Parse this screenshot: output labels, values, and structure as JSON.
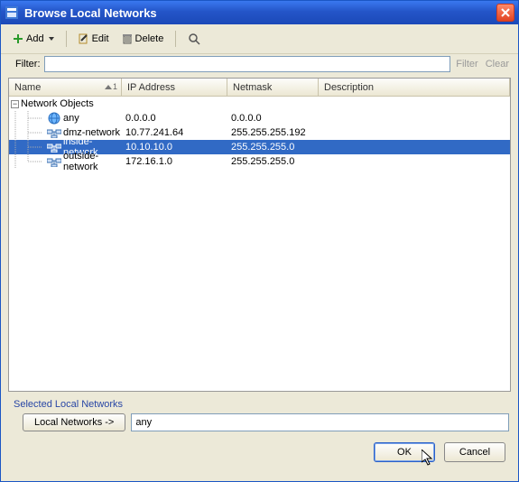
{
  "window": {
    "title": "Browse Local Networks"
  },
  "toolbar": {
    "add_label": "Add",
    "edit_label": "Edit",
    "delete_label": "Delete"
  },
  "filter": {
    "label": "Filter:",
    "value": "",
    "filter_link": "Filter",
    "clear_link": "Clear"
  },
  "columns": {
    "name": "Name",
    "ip": "IP Address",
    "netmask": "Netmask",
    "description": "Description",
    "sort_indicator": "1"
  },
  "tree": {
    "root_label": "Network Objects",
    "rows": [
      {
        "name": "any",
        "ip": "0.0.0.0",
        "netmask": "0.0.0.0",
        "description": "",
        "icon": "globe",
        "selected": false
      },
      {
        "name": "dmz-network",
        "ip": "10.77.241.64",
        "netmask": "255.255.255.192",
        "description": "",
        "icon": "subnet",
        "selected": false
      },
      {
        "name": "inside-network",
        "ip": "10.10.10.0",
        "netmask": "255.255.255.0",
        "description": "",
        "icon": "subnet",
        "selected": true
      },
      {
        "name": "outside-network",
        "ip": "172.16.1.0",
        "netmask": "255.255.255.0",
        "description": "",
        "icon": "subnet",
        "selected": false
      }
    ]
  },
  "selected_section": {
    "header": "Selected Local Networks",
    "button_label": "Local Networks ->",
    "value": "any"
  },
  "buttons": {
    "ok": "OK",
    "cancel": "Cancel"
  }
}
